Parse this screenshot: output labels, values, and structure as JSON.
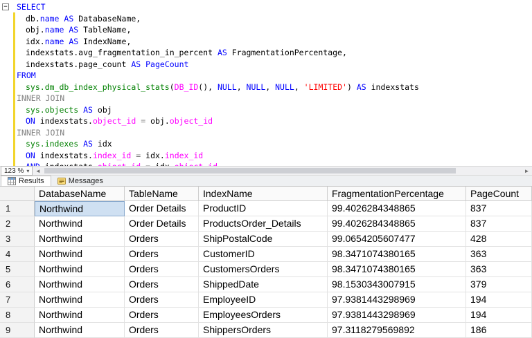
{
  "editor": {
    "zoom_label": "123 %",
    "fold_icon": "−",
    "change_bar_color": "#f2d52c",
    "token_colors": {
      "kw": "#0000ff",
      "gy": "#808080",
      "gr": "#008000",
      "mg": "#ff00ff",
      "st": "#ff0000",
      "tx": "#000000"
    },
    "lines": [
      {
        "indent": 0,
        "tokens": [
          {
            "t": "SELECT",
            "c": "kw"
          }
        ]
      },
      {
        "indent": 1,
        "tokens": [
          {
            "t": "db.",
            "c": "tx"
          },
          {
            "t": "name",
            "c": "kw"
          },
          {
            "t": " ",
            "c": "tx"
          },
          {
            "t": "AS",
            "c": "kw"
          },
          {
            "t": " DatabaseName,",
            "c": "tx"
          }
        ]
      },
      {
        "indent": 1,
        "tokens": [
          {
            "t": "obj.",
            "c": "tx"
          },
          {
            "t": "name",
            "c": "kw"
          },
          {
            "t": " ",
            "c": "tx"
          },
          {
            "t": "AS",
            "c": "kw"
          },
          {
            "t": " TableName,",
            "c": "tx"
          }
        ]
      },
      {
        "indent": 1,
        "tokens": [
          {
            "t": "idx.",
            "c": "tx"
          },
          {
            "t": "name",
            "c": "kw"
          },
          {
            "t": " ",
            "c": "tx"
          },
          {
            "t": "AS",
            "c": "kw"
          },
          {
            "t": " IndexName,",
            "c": "tx"
          }
        ]
      },
      {
        "indent": 1,
        "tokens": [
          {
            "t": "indexstats.avg_fragmentation_in_percent ",
            "c": "tx"
          },
          {
            "t": "AS",
            "c": "kw"
          },
          {
            "t": " FragmentationPercentage,",
            "c": "tx"
          }
        ]
      },
      {
        "indent": 1,
        "tokens": [
          {
            "t": "indexstats.page_count ",
            "c": "tx"
          },
          {
            "t": "AS",
            "c": "kw"
          },
          {
            "t": " ",
            "c": "tx"
          },
          {
            "t": "PageCount",
            "c": "kw"
          }
        ]
      },
      {
        "indent": 0,
        "tokens": [
          {
            "t": "FROM",
            "c": "kw"
          }
        ]
      },
      {
        "indent": 1,
        "tokens": [
          {
            "t": "sys.dm_db_index_physical_stats",
            "c": "gr"
          },
          {
            "t": "(",
            "c": "tx"
          },
          {
            "t": "DB_ID",
            "c": "mg"
          },
          {
            "t": "(), ",
            "c": "tx"
          },
          {
            "t": "NULL",
            "c": "kw"
          },
          {
            "t": ", ",
            "c": "tx"
          },
          {
            "t": "NULL",
            "c": "kw"
          },
          {
            "t": ", ",
            "c": "tx"
          },
          {
            "t": "NULL",
            "c": "kw"
          },
          {
            "t": ", ",
            "c": "tx"
          },
          {
            "t": "'LIMITED'",
            "c": "st"
          },
          {
            "t": ") ",
            "c": "tx"
          },
          {
            "t": "AS",
            "c": "kw"
          },
          {
            "t": " indexstats",
            "c": "tx"
          }
        ]
      },
      {
        "indent": 0,
        "tokens": [
          {
            "t": "INNER JOIN",
            "c": "gy"
          }
        ]
      },
      {
        "indent": 1,
        "tokens": [
          {
            "t": "sys.objects",
            "c": "gr"
          },
          {
            "t": " ",
            "c": "tx"
          },
          {
            "t": "AS",
            "c": "kw"
          },
          {
            "t": " obj",
            "c": "tx"
          }
        ]
      },
      {
        "indent": 1,
        "tokens": [
          {
            "t": "ON",
            "c": "kw"
          },
          {
            "t": " indexstats.",
            "c": "tx"
          },
          {
            "t": "object_id",
            "c": "mg"
          },
          {
            "t": " ",
            "c": "tx"
          },
          {
            "t": "=",
            "c": "gy"
          },
          {
            "t": " obj.",
            "c": "tx"
          },
          {
            "t": "object_id",
            "c": "mg"
          }
        ]
      },
      {
        "indent": 0,
        "tokens": [
          {
            "t": "INNER JOIN",
            "c": "gy"
          }
        ]
      },
      {
        "indent": 1,
        "tokens": [
          {
            "t": "sys.indexes",
            "c": "gr"
          },
          {
            "t": " ",
            "c": "tx"
          },
          {
            "t": "AS",
            "c": "kw"
          },
          {
            "t": " idx",
            "c": "tx"
          }
        ]
      },
      {
        "indent": 1,
        "tokens": [
          {
            "t": "ON",
            "c": "kw"
          },
          {
            "t": " indexstats.",
            "c": "tx"
          },
          {
            "t": "index_id",
            "c": "mg"
          },
          {
            "t": " ",
            "c": "tx"
          },
          {
            "t": "=",
            "c": "gy"
          },
          {
            "t": " idx.",
            "c": "tx"
          },
          {
            "t": "index_id",
            "c": "mg"
          }
        ]
      },
      {
        "indent": 1,
        "tokens": [
          {
            "t": "AND",
            "c": "kw"
          },
          {
            "t": " indexstats.",
            "c": "tx"
          },
          {
            "t": "object_id",
            "c": "mg"
          },
          {
            "t": " ",
            "c": "tx"
          },
          {
            "t": "=",
            "c": "gy"
          },
          {
            "t": " idx.",
            "c": "tx"
          },
          {
            "t": "object_id",
            "c": "mg"
          }
        ]
      }
    ]
  },
  "scrollbar": {
    "left_arrow": "◄",
    "right_arrow": "►",
    "zoom_dropdown_icon": "▾"
  },
  "results_pane": {
    "tabs": [
      {
        "label": "Results",
        "selected": true
      },
      {
        "label": "Messages",
        "selected": false
      }
    ]
  },
  "grid": {
    "columns": [
      "DatabaseName",
      "TableName",
      "IndexName",
      "FragmentationPercentage",
      "PageCount"
    ],
    "rows": [
      [
        "Northwind",
        "Order Details",
        "ProductID",
        "99.4026284348865",
        "837"
      ],
      [
        "Northwind",
        "Order Details",
        "ProductsOrder_Details",
        "99.4026284348865",
        "837"
      ],
      [
        "Northwind",
        "Orders",
        "ShipPostalCode",
        "99.0654205607477",
        "428"
      ],
      [
        "Northwind",
        "Orders",
        "CustomerID",
        "98.3471074380165",
        "363"
      ],
      [
        "Northwind",
        "Orders",
        "CustomersOrders",
        "98.3471074380165",
        "363"
      ],
      [
        "Northwind",
        "Orders",
        "ShippedDate",
        "98.1530343007915",
        "379"
      ],
      [
        "Northwind",
        "Orders",
        "EmployeeID",
        "97.9381443298969",
        "194"
      ],
      [
        "Northwind",
        "Orders",
        "EmployeesOrders",
        "97.9381443298969",
        "194"
      ],
      [
        "Northwind",
        "Orders",
        "ShippersOrders",
        "97.3118279569892",
        "186"
      ]
    ],
    "selected_cell": {
      "row": 0,
      "col": 0
    },
    "selection_color": "#cfe0f2"
  }
}
